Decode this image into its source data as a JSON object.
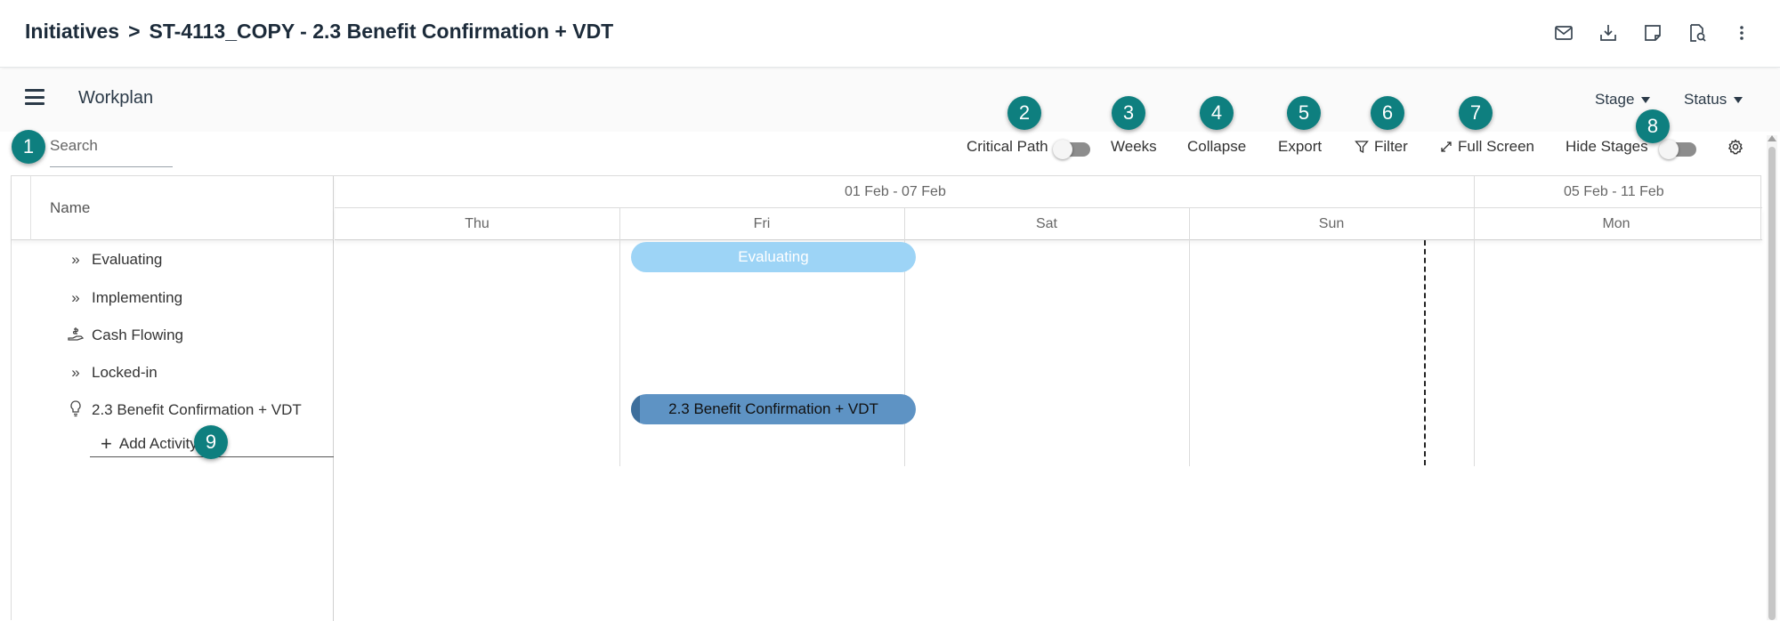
{
  "header": {
    "breadcrumb_root": "Initiatives",
    "separator": ">",
    "initiative_title": "ST-4113_COPY - 2.3 Benefit Confirmation + VDT",
    "icons": [
      "mail-icon",
      "download-icon",
      "note-icon",
      "document-search-icon",
      "more-vertical-icon"
    ]
  },
  "workplan": {
    "title": "Workplan",
    "stage_label": "Stage",
    "status_label": "Status"
  },
  "toolbar": {
    "search_placeholder": "Search",
    "critical_path_label": "Critical Path",
    "critical_path_on": false,
    "weeks_label": "Weeks",
    "collapse_label": "Collapse",
    "export_label": "Export",
    "filter_label": "Filter",
    "full_screen_label": "Full Screen",
    "hide_stages_label": "Hide Stages",
    "hide_stages_on": false
  },
  "badges": [
    "1",
    "2",
    "3",
    "4",
    "5",
    "6",
    "7",
    "8",
    "9"
  ],
  "grid": {
    "name_header": "Name",
    "weeks": [
      "01 Feb - 07 Feb",
      "05 Feb - 11 Feb"
    ],
    "days": [
      "Thu",
      "Fri",
      "Sat",
      "Sun",
      "Mon"
    ],
    "rows": [
      {
        "icon": "double-chevron-icon",
        "label": "Evaluating"
      },
      {
        "icon": "double-chevron-icon",
        "label": "Implementing"
      },
      {
        "icon": "cash-hand-icon",
        "label": "Cash Flowing"
      },
      {
        "icon": "double-chevron-icon",
        "label": "Locked-in"
      },
      {
        "icon": "lightbulb-icon",
        "label": "2.3 Benefit Confirmation + VDT"
      }
    ],
    "add_activity_label": "Add Activity",
    "bars": [
      {
        "label": "Evaluating",
        "color": "#9dd4f6",
        "day": "Fri"
      },
      {
        "label": "2.3 Benefit Confirmation + VDT",
        "color": "#5e93c4",
        "day": "Fri"
      }
    ]
  },
  "colors": {
    "badge": "#0e7f7f",
    "accent": "#7fcfc6"
  }
}
